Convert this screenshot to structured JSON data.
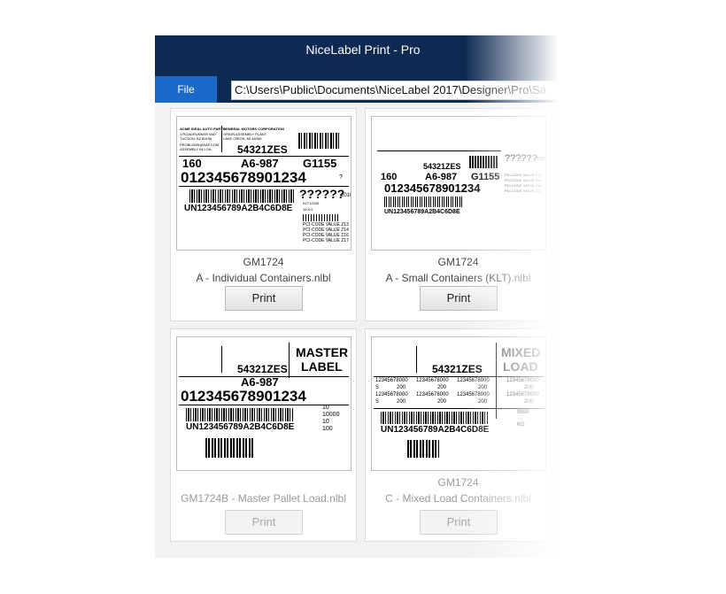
{
  "window": {
    "title": "NiceLabel Print - Pro",
    "file_tab": "File",
    "path": "C:\\Users\\Public\\Documents\\NiceLabel 2017\\Designer\\Pro\\Sa"
  },
  "cards": [
    {
      "code": "GM1724",
      "name": "A - Individual Containers.nlbl",
      "print_label": "Print",
      "enabled": true,
      "label": {
        "from_company": "ACME IDEAL AUTO PARTS",
        "from_addr1": "1 ROADRUNNER WAY",
        "from_addr2": "TUCSON, AZ 89156",
        "to_company": "GENERAL MOTORS CORPORATION",
        "to_addr1": "ORION ASSEMBLY PLANT",
        "to_addr2": "LAKE ORION, MI 48359",
        "email": "PROBLEMS@AAF.COM",
        "note": "ASSEMBLY IN LOA",
        "ref": "54321ZES",
        "qty": "160",
        "part": "A6-987",
        "code": "G1155",
        "serial": "012345678901234",
        "q": "?",
        "date": "??????",
        "year": "2016",
        "kltno": "KLT12345",
        "kg": "16 KG",
        "uid": "UN123456789A2B4C6D8E",
        "pci1": "PCI-CODE VALUE Z13",
        "pci2": "PCI-CODE VALUE Z14",
        "pci3": "PCI-CODE VALUE Z16",
        "pci4": "PCI-CODE VALUE Z17"
      }
    },
    {
      "code": "GM1724",
      "name": "A - Small Containers (KLT).nlbl",
      "print_label": "Print",
      "enabled": true,
      "label": {
        "ref": "54321ZES",
        "qty": "160",
        "part": "A6-987",
        "code": "G1155",
        "serial": "012345678901234",
        "date": "??????",
        "year": "2016",
        "uid": "UN123456789A2B4C6D8E",
        "pci1": "PCI-CODE VALUE Z13",
        "pci2": "PCI-CODE VALUE Z14",
        "pci3": "PCI-CODE VALUE Z16",
        "pci4": "PCI-CODE VALUE Z17"
      }
    },
    {
      "code": "",
      "name": "GM1724B - Master Pallet Load.nlbl",
      "print_label": "Print",
      "enabled": false,
      "label": {
        "banner1": "MASTER",
        "banner2": "LABEL",
        "ref": "54321ZES",
        "part": "A6-987",
        "serial": "012345678901234",
        "uid": "UN123456789A2B4C6D8E",
        "n1": "10",
        "n2": "10000",
        "n3": "10",
        "n4": "100"
      }
    },
    {
      "code": "GM1724",
      "name": "C - Mixed Load Containers.nlbl",
      "print_label": "Print",
      "enabled": false,
      "label": {
        "banner1": "MIXED",
        "banner2": "LOAD",
        "ref": "54321ZES",
        "row_code": "12345678000",
        "row_val": "200",
        "s": "S",
        "uid": "UN123456789A2B4C6D8E",
        "n9": "9999",
        "kg": "KG"
      }
    }
  ]
}
